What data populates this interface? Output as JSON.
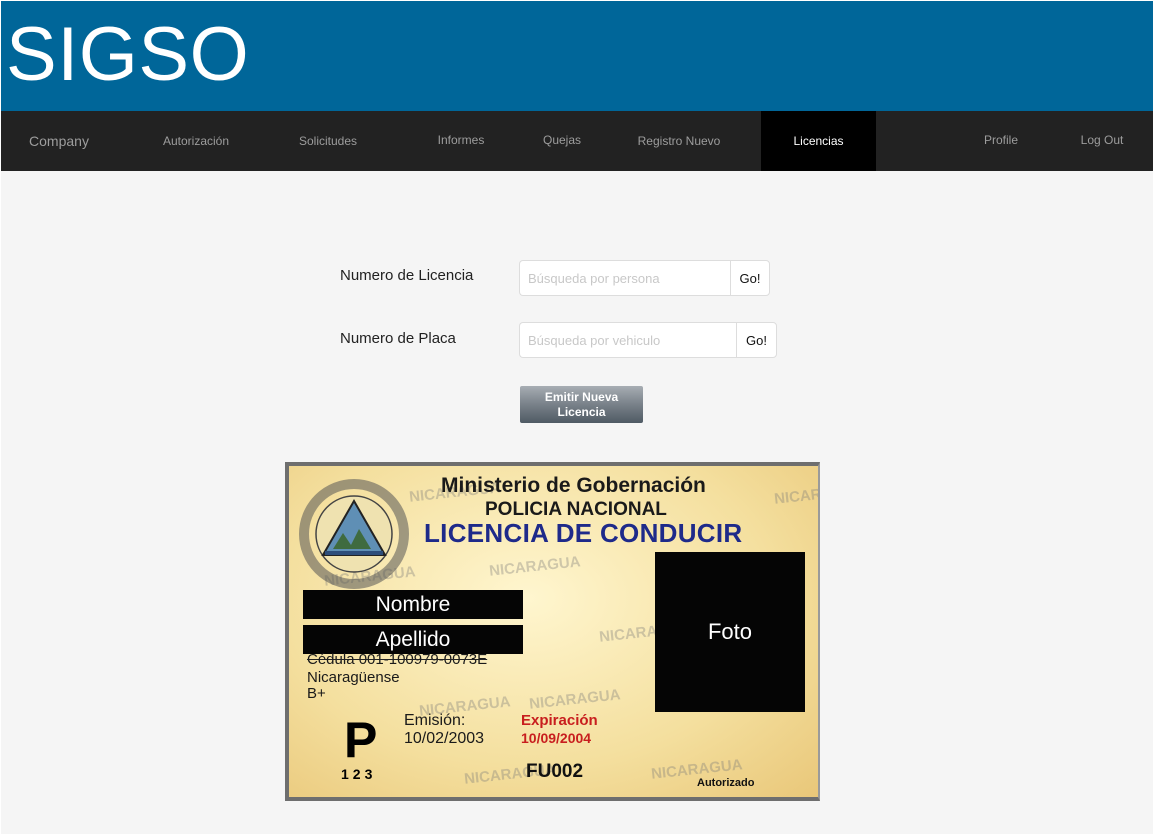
{
  "app": {
    "title": "SIGSO"
  },
  "nav": {
    "brand": "Company",
    "items": [
      {
        "label": "Autorización"
      },
      {
        "label": "Solicitudes"
      },
      {
        "label": "Informes"
      },
      {
        "label": "Quejas"
      },
      {
        "label": "Registro Nuevo"
      },
      {
        "label": "Licencias"
      }
    ],
    "right": [
      {
        "label": "Profile"
      },
      {
        "label": "Log Out"
      }
    ],
    "active": "Licencias"
  },
  "form": {
    "licencia": {
      "label": "Numero de Licencia",
      "placeholder": "Búsqueda por persona",
      "value": "",
      "button": "Go!"
    },
    "placa": {
      "label": "Numero de Placa",
      "placeholder": "Búsqueda por vehiculo",
      "value": "",
      "button": "Go!"
    },
    "emit_button": "Emitir Nueva Licencia"
  },
  "card": {
    "line1": "Ministerio de Gobernación",
    "line2": "POLICIA NACIONAL",
    "line3": "LICENCIA DE CONDUCIR",
    "watermark": "NICARAGUA",
    "nombre": "Nombre",
    "apellido": "Apellido",
    "cedula": "Cédula 001-100979-0073E",
    "nacionalidad": "Nicaragüense",
    "sangre": "B+",
    "categoria": "P",
    "categoria_nums": "123",
    "emision_label": "Emisión:",
    "emision_date": "10/02/2003",
    "expiracion_label": "Expiración",
    "expiracion_date": "10/09/2004",
    "codigo": "FU002",
    "autorizado": "Autorizado",
    "foto": "Foto"
  },
  "colors": {
    "banner": "#006699",
    "navbar": "#222222",
    "nav_active": "#000000",
    "content_bg": "#f5f5f5",
    "card_title_blue": "#1e2a8a",
    "expiry_red": "#c81e1e"
  }
}
